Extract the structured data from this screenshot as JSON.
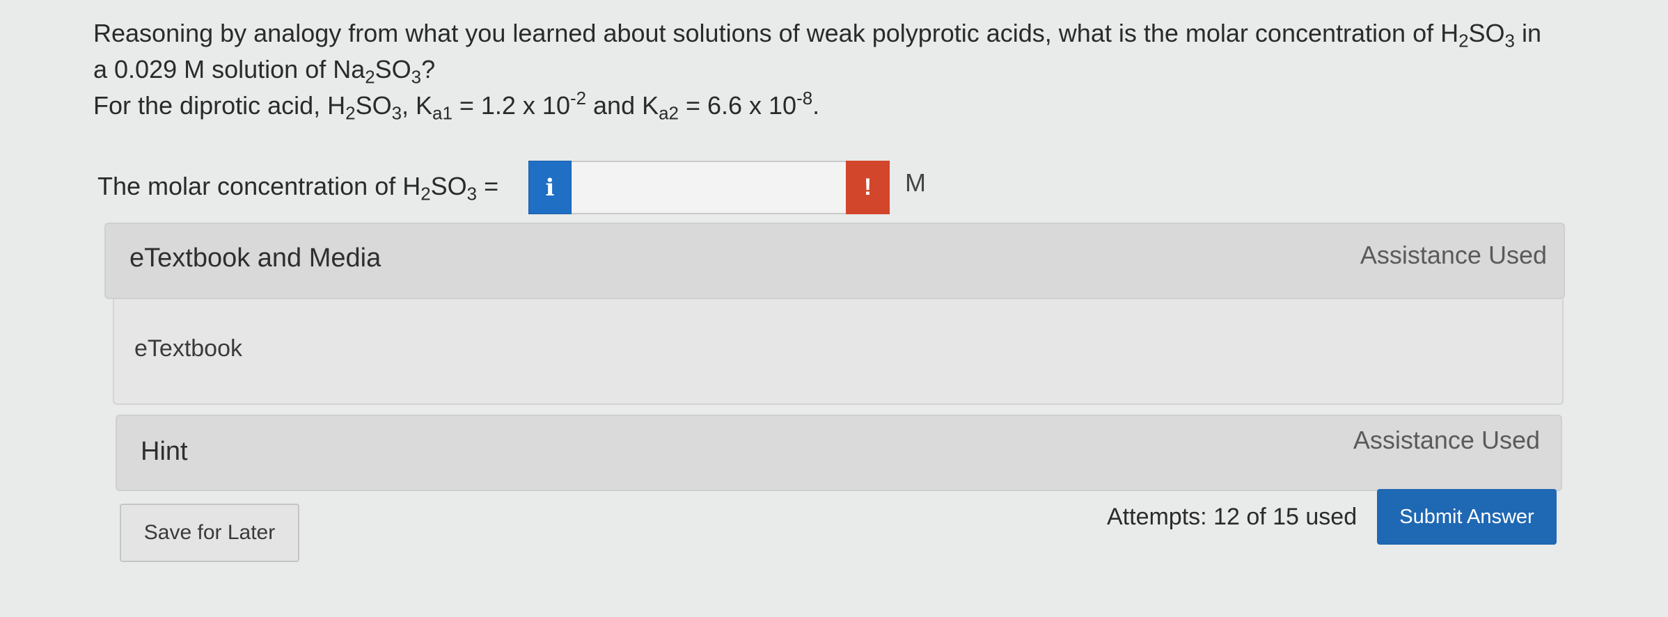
{
  "question": {
    "line1_pre": "Reasoning by analogy from what you learned about solutions of weak polyprotic acids, what is the molar concentration of H",
    "line1_sub1": "2",
    "line1_mid": "SO",
    "line1_sub2": "3",
    "line1_post": " in",
    "line2_pre": "a 0.029 M solution of Na",
    "line2_sub1": "2",
    "line2_mid": "SO",
    "line2_sub2": "3",
    "line2_post": "?",
    "line3_pre": "For the diprotic acid, H",
    "line3_sub1": "2",
    "line3_mid": "SO",
    "line3_sub2": "3",
    "line3_k1_pre": ", K",
    "line3_k1_sub": "a1",
    "line3_k1_val": " = 1.2 x 10",
    "line3_k1_exp": "-2",
    "line3_and": " and K",
    "line3_k2_sub": "a2",
    "line3_k2_val": " = 6.6 x 10",
    "line3_k2_exp": "-8",
    "line3_end": "."
  },
  "answer": {
    "label_pre": "The molar concentration of H",
    "label_sub1": "2",
    "label_mid": "SO",
    "label_sub2": "3",
    "label_post": " =",
    "info_icon": "i",
    "value": "",
    "error_icon": "!",
    "unit": "M"
  },
  "etextbook_panel": {
    "title": "eTextbook and Media",
    "status": "Assistance Used",
    "link": "eTextbook"
  },
  "hint_panel": {
    "title": "Hint",
    "status": "Assistance Used"
  },
  "footer": {
    "save_label": "Save for Later",
    "attempts": "Attempts: 12 of 15 used",
    "submit_label": "Submit Answer"
  },
  "colors": {
    "info_blue": "#1f6fc5",
    "error_red": "#d2462b",
    "submit_blue": "#1f68b4"
  }
}
